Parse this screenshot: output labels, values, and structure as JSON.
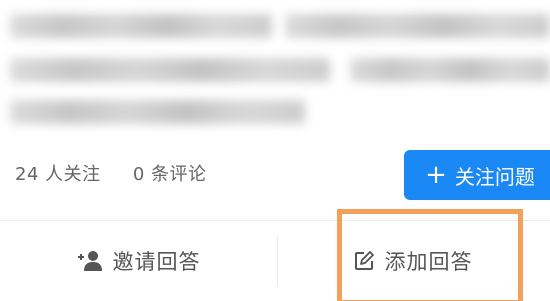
{
  "question": {
    "text_redacted": true
  },
  "meta": {
    "followers": "24 人关注",
    "comments": "0 条评论"
  },
  "follow_button": {
    "icon": "plus-icon",
    "label": "关注问题",
    "color": "#1a88f5"
  },
  "actions": {
    "invite": {
      "icon": "add-person-icon",
      "label": "邀请回答"
    },
    "answer": {
      "icon": "edit-icon",
      "label": "添加回答"
    }
  },
  "highlight": {
    "color": "#f2a05a"
  }
}
